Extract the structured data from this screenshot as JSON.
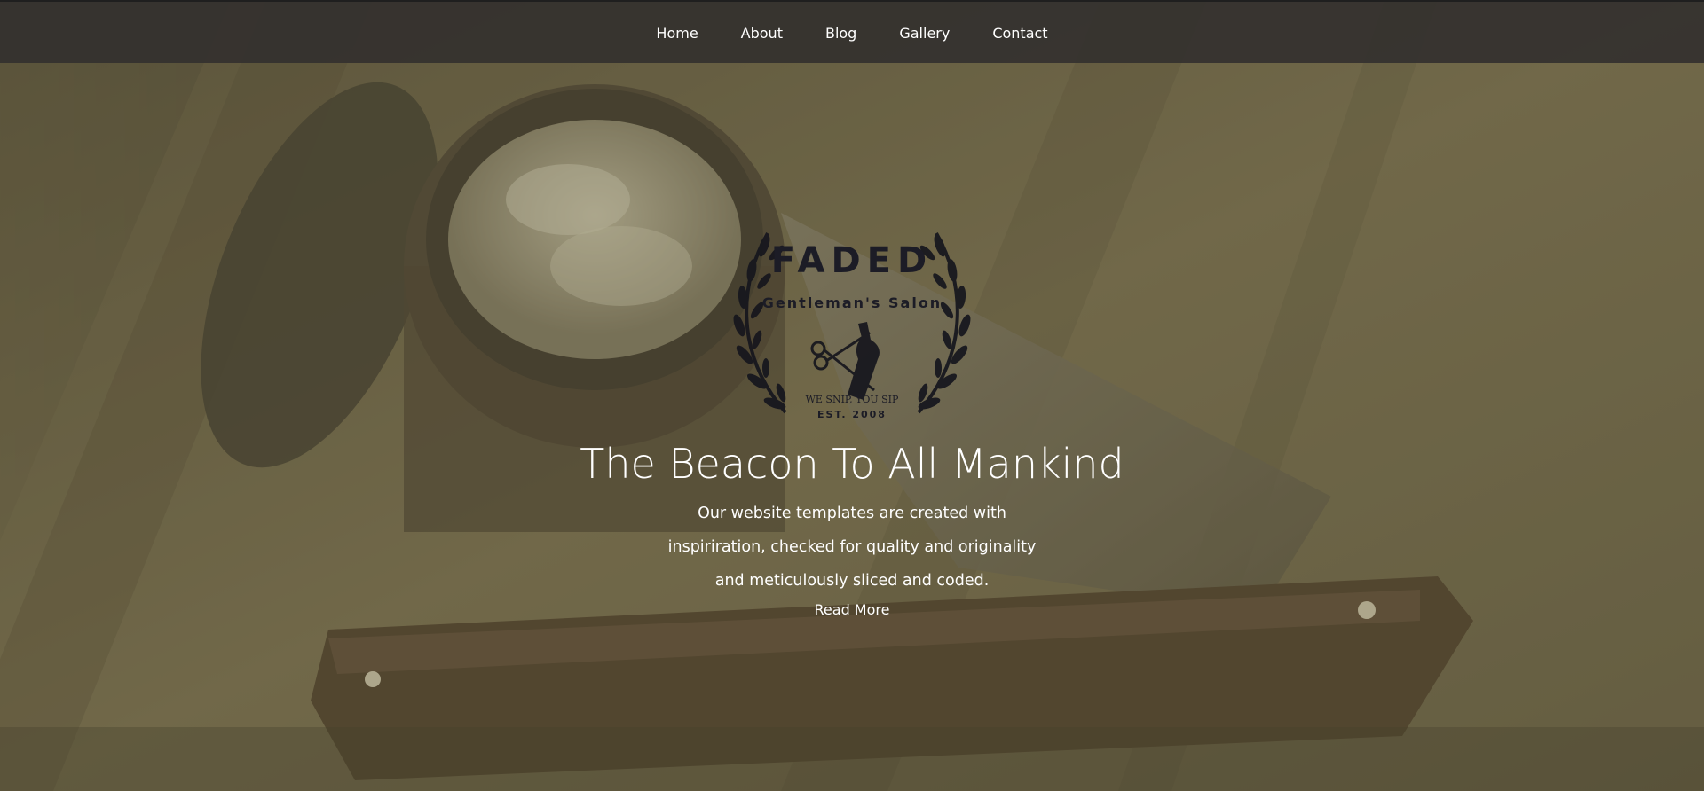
{
  "nav": {
    "items": [
      {
        "label": "Home"
      },
      {
        "label": "About"
      },
      {
        "label": "Blog"
      },
      {
        "label": "Gallery"
      },
      {
        "label": "Contact"
      }
    ]
  },
  "logo": {
    "brand": "FADED",
    "subtitle": "Gentleman's Salon",
    "slogan": "WE SNIP, YOU SIP",
    "established": "EST. 2008"
  },
  "hero": {
    "title": "The Beacon To All Mankind",
    "lines": [
      "Our website templates are created with",
      "inspiriration, checked for quality and originality",
      "and meticulously sliced and coded."
    ],
    "cta_label": "Read More"
  },
  "colors": {
    "nav_background": "#34322e",
    "overlay": "#787352",
    "text": "#ffffff",
    "logo_ink": "#1a1a22"
  }
}
